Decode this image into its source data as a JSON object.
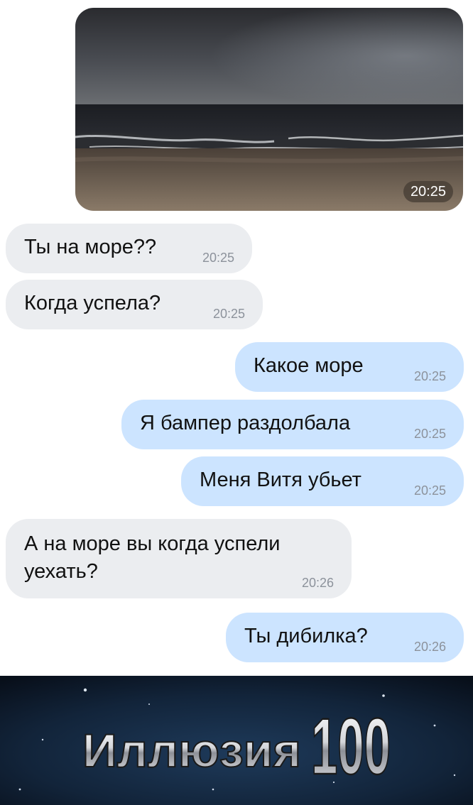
{
  "photo_message": {
    "time": "20:25"
  },
  "messages": [
    {
      "text": "Ты на море??",
      "time": "20:25",
      "direction": "incoming"
    },
    {
      "text": "Когда успела?",
      "time": "20:25",
      "direction": "incoming"
    },
    {
      "text": "Какое море",
      "time": "20:25",
      "direction": "outgoing"
    },
    {
      "text": "Я бампер раздолбала",
      "time": "20:25",
      "direction": "outgoing"
    },
    {
      "text": "Меня Витя убьет",
      "time": "20:25",
      "direction": "outgoing"
    },
    {
      "text": "А на море вы когда успели уехать?",
      "time": "20:26",
      "direction": "incoming"
    },
    {
      "text": "Ты дибилка?",
      "time": "20:26",
      "direction": "outgoing"
    }
  ],
  "meme": {
    "caption_word": "Иллюзия",
    "caption_number": "100"
  },
  "colors": {
    "incoming_bubble": "#ebedf0",
    "outgoing_bubble": "#cce4ff",
    "time_text": "#8c929b",
    "meme_background": "#0e1c2e"
  }
}
